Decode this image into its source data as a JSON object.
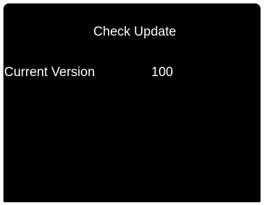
{
  "screen": {
    "title": "Check Update",
    "current_version_label": "Current Version",
    "current_version_value": "100"
  },
  "colors": {
    "background": "#000000",
    "text": "#ffffff",
    "frame": "#ffffff"
  }
}
